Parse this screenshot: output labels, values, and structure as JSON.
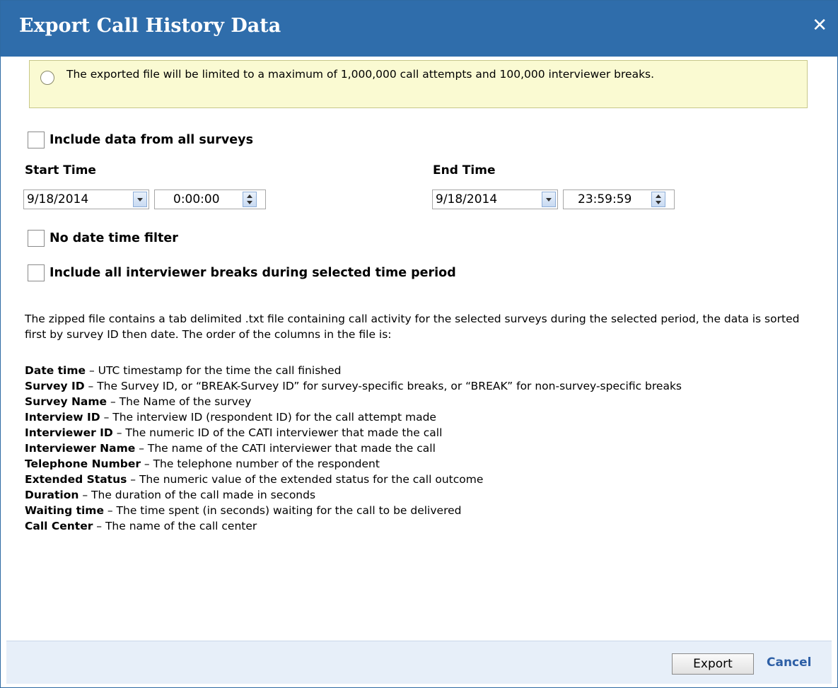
{
  "dialog": {
    "title": "Export Call History Data",
    "close_glyph": "✕"
  },
  "notice": {
    "icon": "info-icon",
    "text": "The exported file will be limited to a maximum of 1,000,000 call attempts and 100,000 interviewer breaks."
  },
  "options": {
    "include_all_surveys": "Include data from all surveys",
    "no_date_time_filter": "No date time filter",
    "include_breaks": "Include all interviewer breaks during selected time period"
  },
  "start": {
    "label": "Start Time",
    "date": "9/18/2014",
    "time": "0:00:00"
  },
  "end": {
    "label": "End Time",
    "date": "9/18/2014",
    "time": "23:59:59"
  },
  "description": "The zipped file contains a tab delimited .txt file containing call activity for the selected surveys during the selected period, the data is sorted first by survey ID then date. The order of the columns in the file is:",
  "columns": [
    {
      "name": "Date time",
      "desc": " – UTC timestamp for the time the call finished"
    },
    {
      "name": "Survey ID",
      "desc": " – The Survey ID, or “BREAK-Survey ID” for survey-specific breaks, or “BREAK” for non-survey-specific breaks"
    },
    {
      "name": "Survey Name",
      "desc": " – The Name of the survey"
    },
    {
      "name": "Interview ID",
      "desc": " – The interview ID (respondent ID) for the call attempt made"
    },
    {
      "name": "Interviewer ID",
      "desc": " – The numeric ID of the CATI interviewer that made the call"
    },
    {
      "name": "Interviewer Name",
      "desc": " – The name of the CATI interviewer that made the call"
    },
    {
      "name": "Telephone Number",
      "desc": " – The telephone number of the respondent"
    },
    {
      "name": "Extended Status",
      "desc": " – The numeric value of the extended status for the call outcome"
    },
    {
      "name": "Duration",
      "desc": " – The duration of the call made in seconds"
    },
    {
      "name": "Waiting time",
      "desc": " – The time spent (in seconds) waiting for the call to be delivered"
    },
    {
      "name": "Call Center",
      "desc": " – The name of the call center"
    }
  ],
  "footer": {
    "export_label": "Export",
    "cancel_label": "Cancel"
  }
}
